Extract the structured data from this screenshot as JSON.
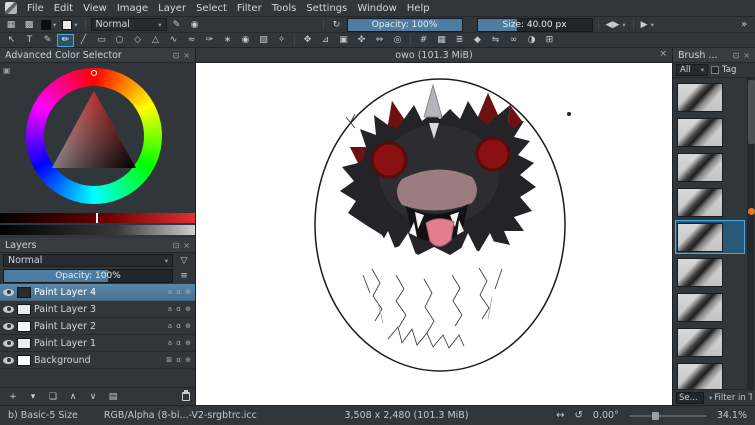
{
  "app": {
    "name": "Krita"
  },
  "colors": {
    "accent": "#3daee9",
    "panel": "#31363b",
    "slider_fill": "#4e7da1",
    "selection": "#4d7698"
  },
  "menubar": {
    "items": [
      "File",
      "Edit",
      "View",
      "Image",
      "Layer",
      "Select",
      "Filter",
      "Tools",
      "Settings",
      "Window",
      "Help"
    ]
  },
  "toolbar_main": {
    "gradient_icon": "▦",
    "pattern_icon": "▩",
    "swatch_arrow": "▾",
    "blend_label": "Normal",
    "combo_arrow": "▾",
    "edit_brush_icon": "✎",
    "choose_preset_icon": "◉",
    "reload_icon": "↻",
    "opacity": {
      "label": "Opacity: 100%",
      "fill_style": "width:100%"
    },
    "size": {
      "label": "Size: 40.00 px",
      "fill_style": "width:35%"
    },
    "mirror_icon": "◀▶",
    "play_icon": "▶",
    "overflow_icon": "»"
  },
  "toolbox": {
    "group1": [
      {
        "name": "select-shapes-tool",
        "glyph": "↖"
      },
      {
        "name": "text-tool",
        "glyph": "T"
      },
      {
        "name": "edit-shapes-tool",
        "glyph": "✎"
      },
      {
        "name": "freehand-brush-tool",
        "glyph": "✏",
        "active": true
      },
      {
        "name": "line-tool",
        "glyph": "╱"
      },
      {
        "name": "rectangle-tool",
        "glyph": "▭"
      },
      {
        "name": "ellipse-tool",
        "glyph": "○"
      },
      {
        "name": "polygon-tool",
        "glyph": "◇"
      },
      {
        "name": "polyline-tool",
        "glyph": "△"
      },
      {
        "name": "bezier-curve-tool",
        "glyph": "∿"
      },
      {
        "name": "freehand-path-tool",
        "glyph": "≈"
      },
      {
        "name": "dynamic-brush-tool",
        "glyph": "✑"
      },
      {
        "name": "multibrush-tool",
        "glyph": "∗"
      },
      {
        "name": "fill-tool",
        "glyph": "◉"
      },
      {
        "name": "gradient-tool",
        "glyph": "▨"
      },
      {
        "name": "color-sampler-tool",
        "glyph": "✧"
      }
    ],
    "group2": [
      {
        "name": "move-tool",
        "glyph": "✥"
      },
      {
        "name": "transform-tool",
        "glyph": "⊿"
      },
      {
        "name": "crop-tool",
        "glyph": "▣"
      },
      {
        "name": "smart-patch-tool",
        "glyph": "✜"
      },
      {
        "name": "pan-tool",
        "glyph": "⇔"
      },
      {
        "name": "zoom-tool",
        "glyph": "◎"
      }
    ],
    "group3": [
      {
        "name": "show-grid-icon",
        "glyph": "#"
      },
      {
        "name": "pixel-grid-icon",
        "glyph": "▦"
      },
      {
        "name": "show-guides-icon",
        "glyph": "≣"
      },
      {
        "name": "snap-icon",
        "glyph": "◆"
      },
      {
        "name": "mirror-view-icon",
        "glyph": "⇋"
      },
      {
        "name": "wrap-around-icon",
        "glyph": "∞"
      },
      {
        "name": "soft-proofing-icon",
        "glyph": "◑"
      },
      {
        "name": "canvas-only-icon",
        "glyph": "⊞"
      }
    ]
  },
  "color_selector": {
    "title": "Advanced Color Selector",
    "settings_icon": "▣",
    "float_icon": "⊡",
    "close_icon": "×",
    "selected_hue": "#ff0000"
  },
  "layers_panel": {
    "title": "Layers",
    "float_icon": "⊡",
    "close_icon": "×",
    "blend_label": "Normal",
    "combo_arrow": "▾",
    "filter_icon": "▽",
    "menu_icon": "≡",
    "opacity": {
      "label": "Opacity:  100%",
      "fill_style": "width:62%"
    },
    "rows": [
      {
        "name": "Paint Layer 4",
        "selected": true,
        "thumb_style": "background:#2a2a2f",
        "badges": "a α ⊕"
      },
      {
        "name": "Paint Layer 3",
        "thumb_style": "background:#e9e9e9",
        "badges": "a α ⊕"
      },
      {
        "name": "Paint Layer 2",
        "thumb_style": "background:#f5f5f5",
        "badges": "a α ⊕"
      },
      {
        "name": "Paint Layer 1",
        "thumb_style": "background:#ededed",
        "badges": "a α ⊕"
      },
      {
        "name": "Background",
        "thumb_style": "background:#ffffff",
        "badges": "⊠ α ⊕"
      }
    ],
    "footer": [
      {
        "name": "add-layer-button",
        "glyph": "+"
      },
      {
        "name": "add-layer-dropdown",
        "glyph": "▾"
      },
      {
        "name": "duplicate-layer-button",
        "glyph": "❏"
      },
      {
        "name": "move-layer-up-button",
        "glyph": "∧"
      },
      {
        "name": "move-layer-down-button",
        "glyph": "∨"
      },
      {
        "name": "layer-properties-button",
        "glyph": "▤"
      }
    ]
  },
  "canvas": {
    "title": "owo (101.3 MiB)",
    "close_icon": "×"
  },
  "artwork": {
    "outline": "#1a1a1a",
    "fur": "#242428",
    "fur_light": "#2c2c31",
    "ear_red": "#6e1111",
    "eye_red": "#8a1111",
    "eye_ring": "#570b0b",
    "horn": "#b3b5b8",
    "horn_light": "#d9dadc",
    "snout": "#9b7d80",
    "mouth": "#121214",
    "fang": "#f4f4f4",
    "tongue": "#e27e8e",
    "tongue_edge": "#b05a6a",
    "fluff": "#ffffff",
    "sketch": "#2f2f2f"
  },
  "brush_dock": {
    "title": "Brush ...",
    "float_icon": "⊡",
    "close_icon": "×",
    "all_label": "All",
    "combo_arrow": "▾",
    "tag_label": "Tag",
    "presets": [
      {
        "name": "brush-preset-1"
      },
      {
        "name": "brush-preset-2"
      },
      {
        "name": "brush-preset-3"
      },
      {
        "name": "brush-preset-4"
      },
      {
        "name": "brush-preset-5",
        "selected": true
      },
      {
        "name": "brush-preset-6"
      },
      {
        "name": "brush-preset-7"
      },
      {
        "name": "brush-preset-8"
      },
      {
        "name": "brush-preset-9"
      }
    ],
    "search_value": "Se...",
    "filter_label": "Filter in Ta"
  },
  "statusbar": {
    "brush_preset": "b) Basic-5 Size",
    "color_profile": "RGB/Alpha (8-bi...-V2-srgbtrc.icc",
    "canvas_size": "3,508 x 2,480 (101.3 MiB)",
    "fit_icon": "↔",
    "rotate_icon": "↺",
    "angle": "0.00°",
    "zoom": "34.1%"
  }
}
